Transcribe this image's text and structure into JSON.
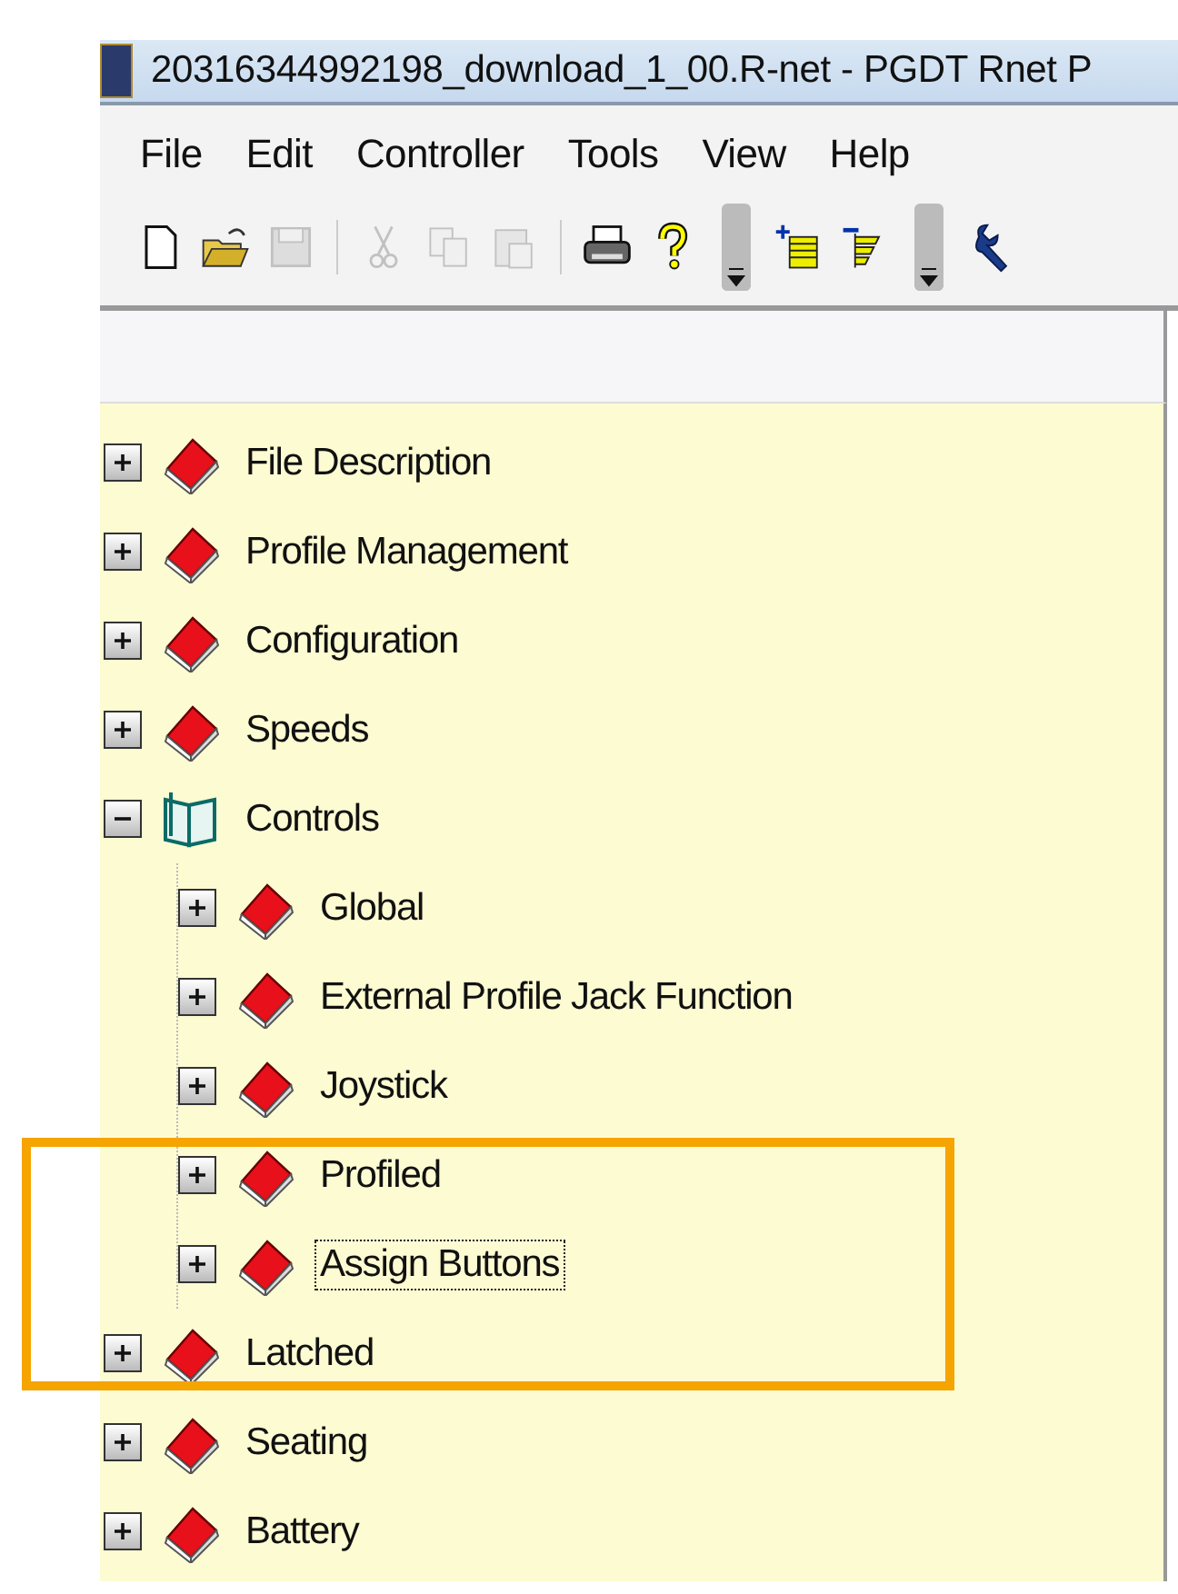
{
  "window": {
    "title": "20316344992198_download_1_00.R-net - PGDT Rnet P"
  },
  "menu": [
    "File",
    "Edit",
    "Controller",
    "Tools",
    "View",
    "Help"
  ],
  "toolbar": [
    {
      "kind": "new",
      "disabled": false
    },
    {
      "kind": "open",
      "disabled": false
    },
    {
      "kind": "save",
      "disabled": true
    },
    {
      "kind": "separator"
    },
    {
      "kind": "cut",
      "disabled": true
    },
    {
      "kind": "copy",
      "disabled": true
    },
    {
      "kind": "paste",
      "disabled": true
    },
    {
      "kind": "separator"
    },
    {
      "kind": "print",
      "disabled": false
    },
    {
      "kind": "help",
      "disabled": false
    },
    {
      "kind": "dropdown"
    },
    {
      "kind": "expand-all",
      "disabled": false
    },
    {
      "kind": "collapse-all",
      "disabled": false
    },
    {
      "kind": "dropdown"
    },
    {
      "kind": "wrench",
      "disabled": false
    }
  ],
  "tree": [
    {
      "label": "File Description",
      "expanded": false,
      "selected": false
    },
    {
      "label": "Profile Management",
      "expanded": false,
      "selected": false
    },
    {
      "label": "Configuration",
      "expanded": false,
      "selected": false
    },
    {
      "label": "Speeds",
      "expanded": false,
      "selected": false
    },
    {
      "label": "Controls",
      "expanded": true,
      "selected": false,
      "children": [
        {
          "label": "Global",
          "expanded": false,
          "selected": false
        },
        {
          "label": "External Profile Jack Function",
          "expanded": false,
          "selected": false
        },
        {
          "label": "Joystick",
          "expanded": false,
          "selected": false
        },
        {
          "label": "Profiled",
          "expanded": false,
          "selected": false
        },
        {
          "label": "Assign Buttons",
          "expanded": false,
          "selected": true
        }
      ]
    },
    {
      "label": "Latched",
      "expanded": false,
      "selected": false
    },
    {
      "label": "Seating",
      "expanded": false,
      "selected": false
    },
    {
      "label": "Battery",
      "expanded": false,
      "selected": false
    }
  ]
}
